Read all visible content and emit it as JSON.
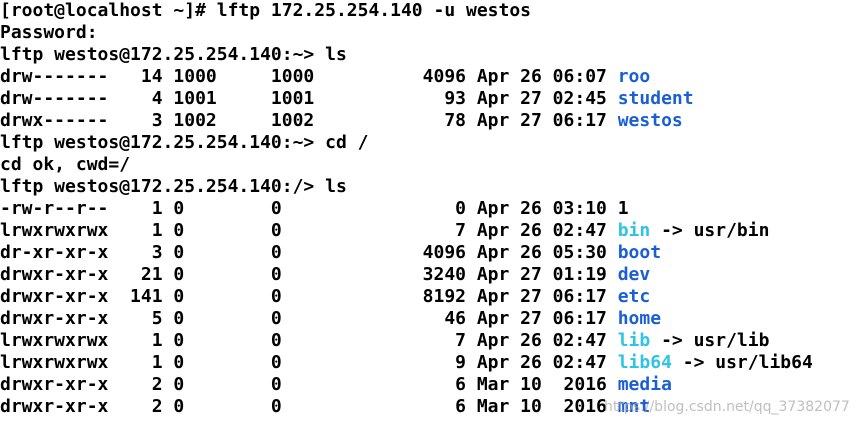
{
  "colors": {
    "background": "#ffffff",
    "text": "#000000",
    "directory": "#1a5fd6",
    "symlink": "#2fc3e8",
    "watermark": "#aaaaaa"
  },
  "terminal": {
    "lines": [
      {
        "kind": "text",
        "text": "[root@localhost ~]# lftp 172.25.254.140 -u westos"
      },
      {
        "kind": "text",
        "text": "Password:"
      },
      {
        "kind": "text",
        "text": "lftp westos@172.25.254.140:~> ls"
      },
      {
        "kind": "entry",
        "prefix": "drw-------   14 1000     1000          4096 Apr 26 06:07 ",
        "name": "roo",
        "type": "dir",
        "suffix": ""
      },
      {
        "kind": "entry",
        "prefix": "drw-------    4 1001     1001            93 Apr 27 02:45 ",
        "name": "student",
        "type": "dir",
        "suffix": ""
      },
      {
        "kind": "entry",
        "prefix": "drwx------    3 1002     1002            78 Apr 27 06:17 ",
        "name": "westos",
        "type": "dir",
        "suffix": ""
      },
      {
        "kind": "text",
        "text": "lftp westos@172.25.254.140:~> cd /"
      },
      {
        "kind": "text",
        "text": "cd ok, cwd=/"
      },
      {
        "kind": "text",
        "text": "lftp westos@172.25.254.140:/> ls"
      },
      {
        "kind": "entry",
        "prefix": "-rw-r--r--    1 0        0                0 Apr 26 03:10 ",
        "name": "1",
        "type": "file",
        "suffix": ""
      },
      {
        "kind": "entry",
        "prefix": "lrwxrwxrwx    1 0        0                7 Apr 26 02:47 ",
        "name": "bin",
        "type": "link",
        "suffix": " -> usr/bin"
      },
      {
        "kind": "entry",
        "prefix": "dr-xr-xr-x    3 0        0             4096 Apr 26 05:30 ",
        "name": "boot",
        "type": "dir",
        "suffix": ""
      },
      {
        "kind": "entry",
        "prefix": "drwxr-xr-x   21 0        0             3240 Apr 27 01:19 ",
        "name": "dev",
        "type": "dir",
        "suffix": ""
      },
      {
        "kind": "entry",
        "prefix": "drwxr-xr-x  141 0        0             8192 Apr 27 06:17 ",
        "name": "etc",
        "type": "dir",
        "suffix": ""
      },
      {
        "kind": "entry",
        "prefix": "drwxr-xr-x    5 0        0               46 Apr 27 06:17 ",
        "name": "home",
        "type": "dir",
        "suffix": ""
      },
      {
        "kind": "entry",
        "prefix": "lrwxrwxrwx    1 0        0                7 Apr 26 02:47 ",
        "name": "lib",
        "type": "link",
        "suffix": " -> usr/lib"
      },
      {
        "kind": "entry",
        "prefix": "lrwxrwxrwx    1 0        0                9 Apr 26 02:47 ",
        "name": "lib64",
        "type": "link",
        "suffix": " -> usr/lib64"
      },
      {
        "kind": "entry",
        "prefix": "drwxr-xr-x    2 0        0                6 Mar 10  2016 ",
        "name": "media",
        "type": "dir",
        "suffix": ""
      },
      {
        "kind": "entry",
        "prefix": "drwxr-xr-x    2 0        0                6 Mar 10  2016 ",
        "name": "mnt",
        "type": "dir",
        "suffix": ""
      }
    ]
  },
  "watermark": {
    "text": "https://blog.csdn.net/qq_37382077"
  }
}
